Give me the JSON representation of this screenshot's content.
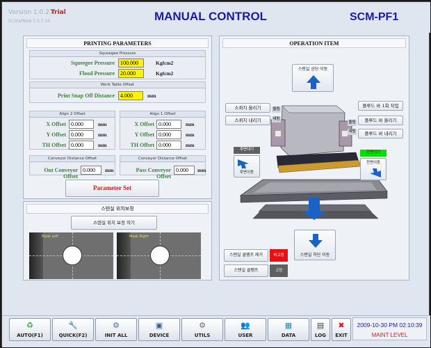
{
  "header": {
    "version": "Version 1.0.27",
    "trial": "Trial",
    "subversion": "ECStarNew 1.0.7.16",
    "title": "MANUAL CONTROL",
    "model": "SCM-PF1"
  },
  "printing": {
    "title": "PRINTING PARAMETERS",
    "squeegee": {
      "group_title": "Squeegee Pressure",
      "squeegee_label": "Squeegee Pressure",
      "squeegee_value": "100.000",
      "flood_label": "Flood Pressure",
      "flood_value": "20.000",
      "unit": "Kgfcm2"
    },
    "worktable": {
      "group_title": "Work Table Offset",
      "label": "Print Snap Off Distance",
      "value": "4.000",
      "unit": "mm"
    },
    "align2": {
      "group_title": "Align 2 Offset",
      "x_label": "X Offset",
      "x_value": "0.000",
      "y_label": "Y Offset",
      "y_value": "0.000",
      "th_label": "TH Offset",
      "th_value": "0.000",
      "unit": "mm"
    },
    "align1": {
      "group_title": "Align 1 Offset",
      "x_label": "X Offset",
      "x_value": "0.000",
      "y_label": "Y Offset",
      "y_value": "0.000",
      "th_label": "TH Offset",
      "th_value": "0.000",
      "unit": "mm"
    },
    "conveyor_out": {
      "group_title": "Conveyor Distance Offset",
      "label": "Out Conveyor Offset",
      "value": "0.000",
      "unit": "mm"
    },
    "conveyor_pass": {
      "group_title": "Conveyor Distance Offset",
      "label": "Pass Conveyor Offset",
      "value": "0.000",
      "unit": "mm"
    },
    "param_set_label": "Parameter Set"
  },
  "stencil": {
    "title": "스텐실 위치보정",
    "button_label": "스텐실 위치 보정 하기",
    "left_image_label": "Mask Left",
    "right_image_label": "Mask Right"
  },
  "operation": {
    "title": "OPERATION ITEM",
    "stencil_up": "스텐실 상단 이동",
    "stencil_down": "스텐실 하단 이동",
    "squeegee_up": "스퀴지 올리기",
    "squeegee_down": "스퀴지 내리기",
    "squeegee_up_tag": "올림",
    "squeegee_down_tag": "내림",
    "flood_once": "플루드 바 1회 작업",
    "flood_up": "플루드 바 올리기",
    "flood_down": "플루드 바 내리기",
    "flood_up_tag": "올림",
    "flood_down_tag": "내림",
    "rear_status": "후면대기",
    "rear_move": "후면이동",
    "front_status": "전면대기",
    "front_move": "전면이동",
    "clamp_remove": "스텐실 클램프 제거",
    "clamp_remove_status": "비고정",
    "clamp": "스텐실 클램프",
    "clamp_status": "고정"
  },
  "bottom": {
    "buttons": [
      {
        "label": "AUTO(F1)",
        "icon": "recycle-icon"
      },
      {
        "label": "QUICK(F2)",
        "icon": "wrench-icon"
      },
      {
        "label": "INIT ALL",
        "icon": "init-icon"
      },
      {
        "label": "DEVICE",
        "icon": "device-icon"
      },
      {
        "label": "UTILS",
        "icon": "gears-icon"
      },
      {
        "label": "USER",
        "icon": "users-icon"
      },
      {
        "label": "DATA",
        "icon": "data-icon"
      },
      {
        "label": "LOG",
        "icon": "log-icon"
      },
      {
        "label": "EXIT",
        "icon": "exit-icon"
      }
    ],
    "datetime": "2009-10-30 PM 02:10:39",
    "level": "MAINT LEVEL"
  },
  "colors": {
    "title_blue": "#1a1aa8",
    "label_green": "#3d7e3d",
    "input_yellow": "#fff200",
    "alert_red": "#d81818",
    "status_green": "#00e000",
    "status_gray": "#606060",
    "arrow_blue": "#1a62c8"
  }
}
